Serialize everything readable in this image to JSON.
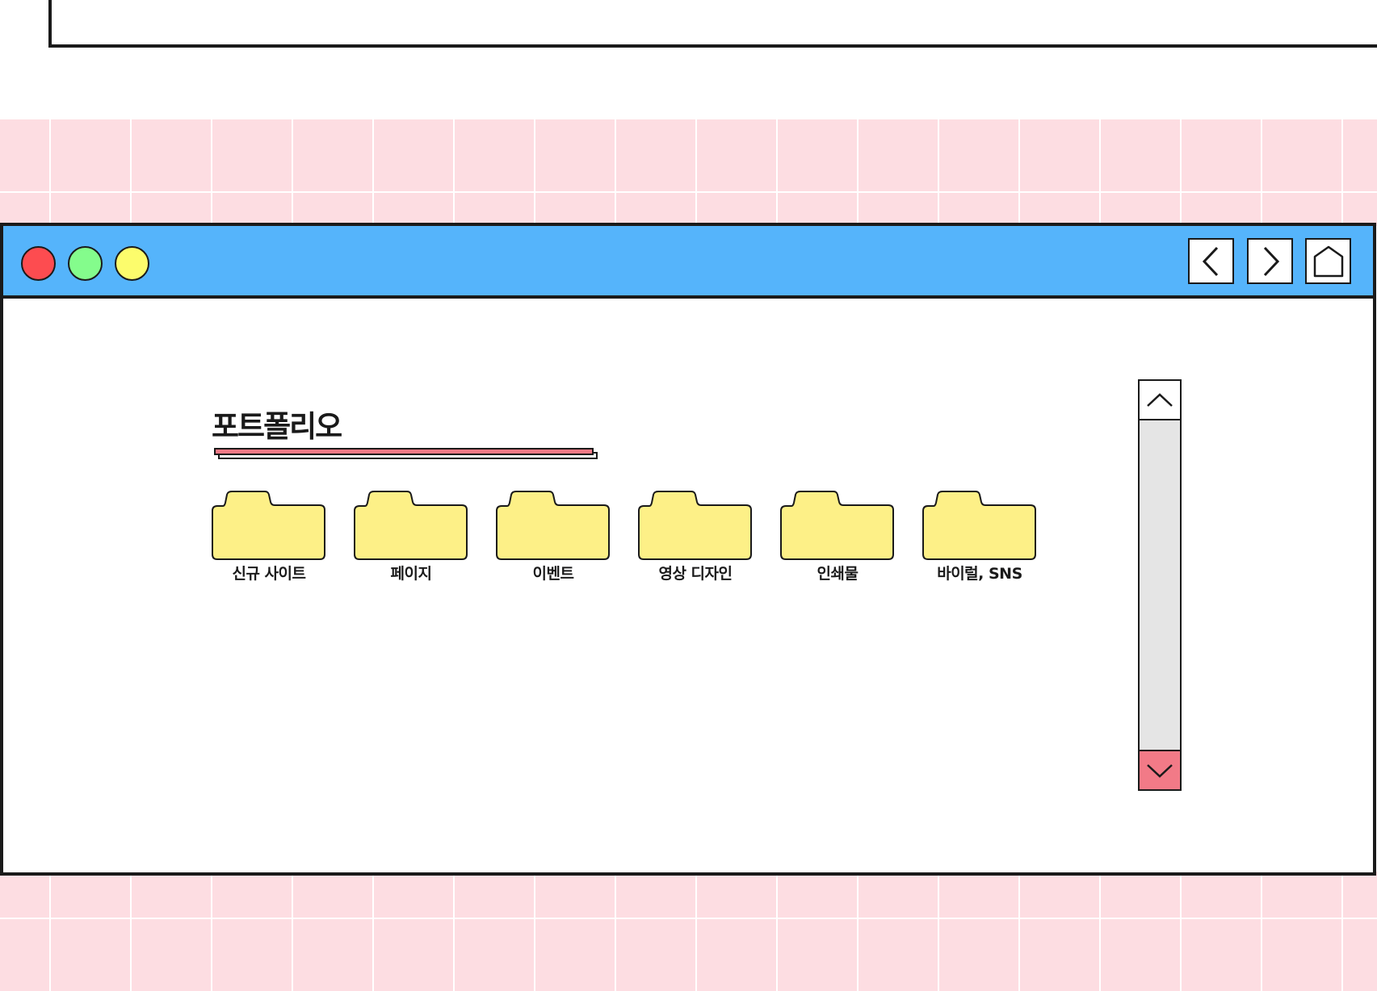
{
  "window": {
    "controls": [
      {
        "name": "close",
        "color": "#fd4c50"
      },
      {
        "name": "minimize",
        "color": "#84fc8c"
      },
      {
        "name": "maximize",
        "color": "#fcfc6c"
      }
    ],
    "titlebar_color": "#55b4fb",
    "nav": {
      "back_icon": "chevron-left-icon",
      "forward_icon": "chevron-right-icon",
      "home_icon": "home-icon"
    }
  },
  "main": {
    "title": "포트폴리오",
    "accent_color": "#f27a87",
    "folder_color": "#fdf087",
    "folders": [
      {
        "label": "신규 사이트"
      },
      {
        "label": "페이지"
      },
      {
        "label": "이벤트"
      },
      {
        "label": "영상 디자인"
      },
      {
        "label": "인쇄물"
      },
      {
        "label": "바이럴, SNS"
      }
    ]
  },
  "scrollbar": {
    "up_icon": "chevron-up-icon",
    "down_icon": "chevron-down-icon"
  },
  "background": {
    "grid_color": "#fddde2"
  }
}
